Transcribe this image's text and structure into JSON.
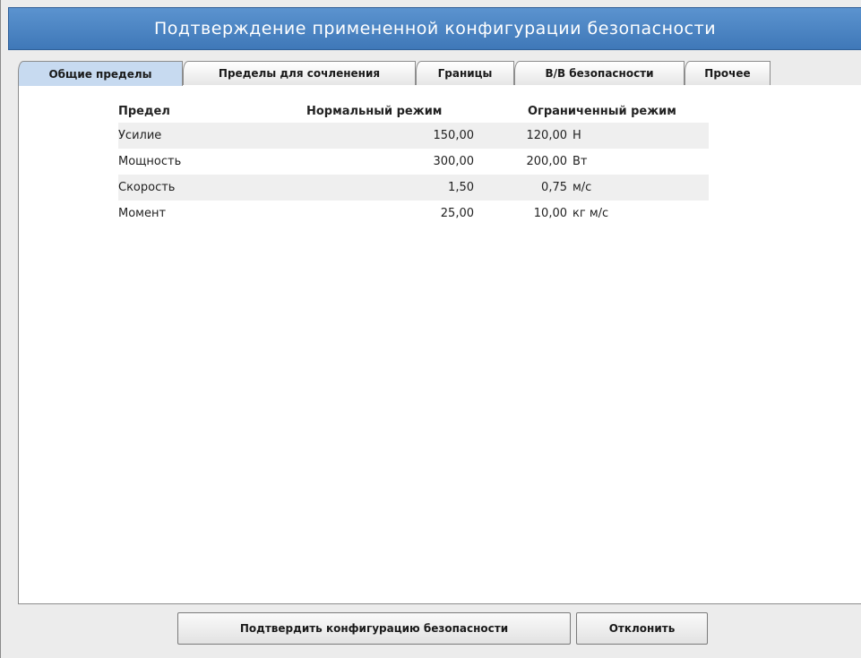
{
  "window": {
    "title": "Подтверждение примененной конфигурации безопасности"
  },
  "tabs": [
    {
      "label": "Общие пределы",
      "active": true
    },
    {
      "label": "Пределы для сочленения",
      "active": false
    },
    {
      "label": "Границы",
      "active": false
    },
    {
      "label": "В/В безопасности",
      "active": false
    },
    {
      "label": "Прочее",
      "active": false
    }
  ],
  "table": {
    "headers": {
      "limit": "Предел",
      "normal": "Нормальный режим",
      "limited": "Ограниченный режим"
    },
    "rows": [
      {
        "name": "Усилие",
        "normal": "150,00",
        "limited": "120,00",
        "unit": "Н"
      },
      {
        "name": "Мощность",
        "normal": "300,00",
        "limited": "200,00",
        "unit": "Вт"
      },
      {
        "name": "Скорость",
        "normal": "1,50",
        "limited": "0,75",
        "unit": "м/с"
      },
      {
        "name": "Момент",
        "normal": "25,00",
        "limited": "10,00",
        "unit": "кг м/с"
      }
    ]
  },
  "buttons": {
    "confirm": "Подтвердить конфигурацию безопасности",
    "reject": "Отклонить"
  },
  "colors": {
    "title_bar": "#4a86c5",
    "active_tab": "#c7daf0"
  }
}
